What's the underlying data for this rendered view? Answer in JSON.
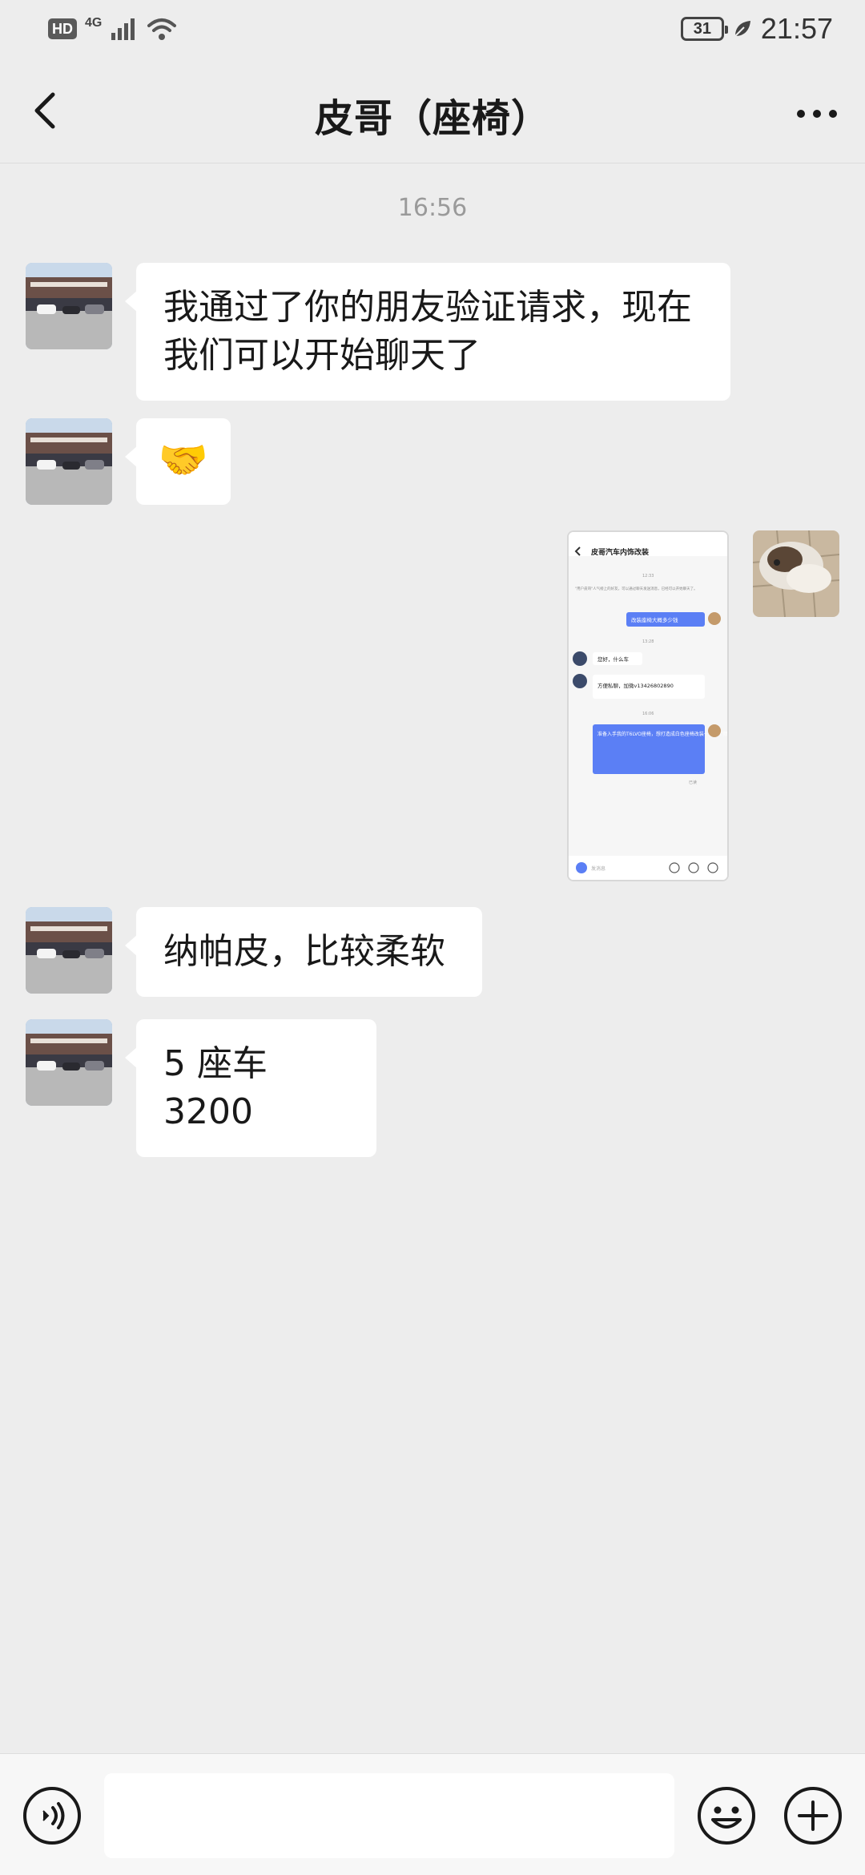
{
  "status_bar": {
    "hd": "HD",
    "network": "4G",
    "battery": "31",
    "time": "21:57"
  },
  "header": {
    "title": "皮哥（座椅）"
  },
  "chat": {
    "timestamp": "16:56",
    "messages": [
      {
        "side": "left",
        "type": "text",
        "text": "我通过了你的朋友验证请求，现在我们可以开始聊天了"
      },
      {
        "side": "left",
        "type": "emoji",
        "text": "🤝"
      },
      {
        "side": "right",
        "type": "image",
        "description": "chat screenshot"
      },
      {
        "side": "left",
        "type": "text",
        "text": "纳帕皮，比较柔软"
      },
      {
        "side": "left",
        "type": "text",
        "text": "5 座车 3200"
      }
    ]
  },
  "screenshot": {
    "title": "皮哥汽车内饰改装",
    "time1": "12:33",
    "notice": "\"用户皮哥\"人气榜上的好友，可以通过聊天发送消息，已经可以开始聊天了。",
    "msg_out1": "改装座椅大概多少钱",
    "time2": "13:28",
    "msg_in1": "您好，什么车",
    "msg_in2": "方便私聊，加微v13426802890",
    "time3": "16:06",
    "msg_out2": "准备入手我的T6LVO座椅，想打造成白色座椅改装一点像个颜色大概多少钱。",
    "read": "已读",
    "input_placeholder": "发消息"
  },
  "colors": {
    "background": "#ededed",
    "bubble": "#ffffff",
    "accent_blue": "#5b7ff5"
  },
  "icons": {
    "back": "chevron-left-icon",
    "more": "more-dots-icon",
    "voice": "voice-icon",
    "emoji": "smile-icon",
    "plus": "plus-icon"
  }
}
